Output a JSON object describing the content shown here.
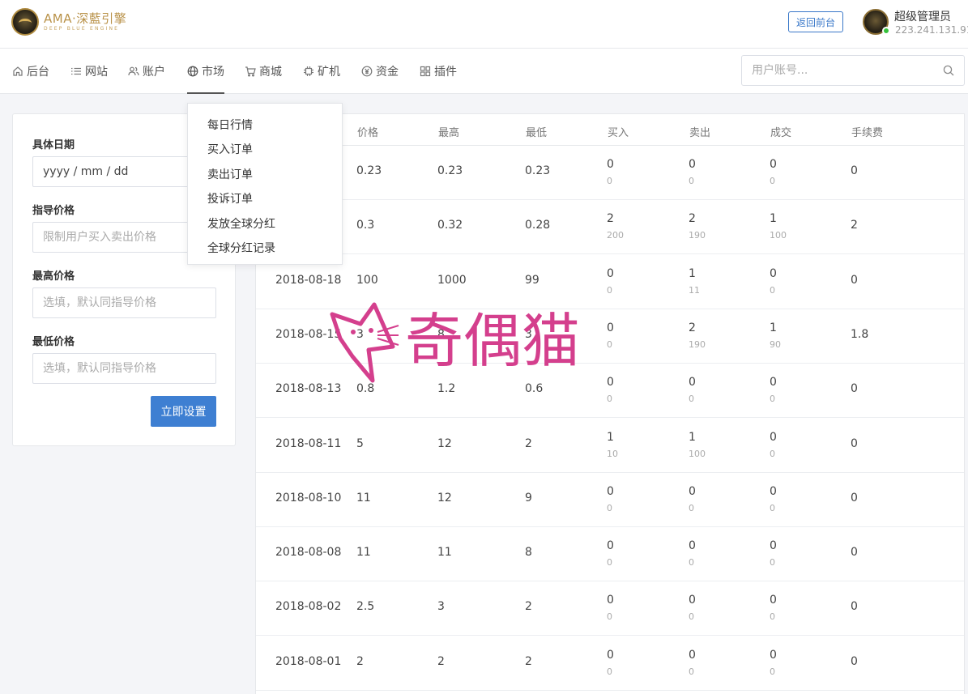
{
  "header": {
    "logo_main": "AMA·深藍引擎",
    "logo_sub": "DEEP BLUE ENGINE",
    "back_button": "返回前台",
    "user_name": "超级管理员",
    "user_ip": "223.241.131.91"
  },
  "nav": {
    "items": [
      {
        "label": "后台",
        "icon": "home-icon"
      },
      {
        "label": "网站",
        "icon": "list-icon"
      },
      {
        "label": "账户",
        "icon": "users-icon"
      },
      {
        "label": "市场",
        "icon": "globe-icon"
      },
      {
        "label": "商城",
        "icon": "cart-icon"
      },
      {
        "label": "矿机",
        "icon": "chip-icon"
      },
      {
        "label": "资金",
        "icon": "yen-icon"
      },
      {
        "label": "插件",
        "icon": "grid-icon"
      }
    ],
    "active": "市场",
    "search_placeholder": "用户账号..."
  },
  "dropdown": {
    "items": [
      "每日行情",
      "买入订单",
      "卖出订单",
      "投诉订单",
      "发放全球分红",
      "全球分红记录"
    ]
  },
  "form": {
    "date_label": "具体日期",
    "date_value": "yyyy / mm / dd",
    "guide_label": "指导价格",
    "guide_placeholder": "限制用户买入卖出价格",
    "max_label": "最高价格",
    "max_placeholder": "选填，默认同指导价格",
    "min_label": "最低价格",
    "min_placeholder": "选填，默认同指导价格",
    "submit": "立即设置"
  },
  "table": {
    "headers": [
      "价格",
      "最高",
      "最低",
      "买入",
      "卖出",
      "成交",
      "手续费"
    ],
    "rows": [
      {
        "date": "",
        "price": "0.23",
        "high": "0.23",
        "low": "0.23",
        "buy": "0",
        "buy_sub": "0",
        "sell": "0",
        "sell_sub": "0",
        "deal": "0",
        "deal_sub": "0",
        "fee": "0"
      },
      {
        "date": "",
        "price": "0.3",
        "high": "0.32",
        "low": "0.28",
        "buy": "2",
        "buy_sub": "200",
        "sell": "2",
        "sell_sub": "190",
        "deal": "1",
        "deal_sub": "100",
        "fee": "2"
      },
      {
        "date": "2018-08-18",
        "price": "100",
        "high": "1000",
        "low": "99",
        "buy": "0",
        "buy_sub": "0",
        "sell": "1",
        "sell_sub": "11",
        "deal": "0",
        "deal_sub": "0",
        "fee": "0"
      },
      {
        "date": "2018-08-15",
        "price": "3",
        "high": "8",
        "low": "3",
        "buy": "0",
        "buy_sub": "0",
        "sell": "2",
        "sell_sub": "190",
        "deal": "1",
        "deal_sub": "90",
        "fee": "1.8"
      },
      {
        "date": "2018-08-13",
        "price": "0.8",
        "high": "1.2",
        "low": "0.6",
        "buy": "0",
        "buy_sub": "0",
        "sell": "0",
        "sell_sub": "0",
        "deal": "0",
        "deal_sub": "0",
        "fee": "0"
      },
      {
        "date": "2018-08-11",
        "price": "5",
        "high": "12",
        "low": "2",
        "buy": "1",
        "buy_sub": "10",
        "sell": "1",
        "sell_sub": "100",
        "deal": "0",
        "deal_sub": "0",
        "fee": "0"
      },
      {
        "date": "2018-08-10",
        "price": "11",
        "high": "12",
        "low": "9",
        "buy": "0",
        "buy_sub": "0",
        "sell": "0",
        "sell_sub": "0",
        "deal": "0",
        "deal_sub": "0",
        "fee": "0"
      },
      {
        "date": "2018-08-08",
        "price": "11",
        "high": "11",
        "low": "8",
        "buy": "0",
        "buy_sub": "0",
        "sell": "0",
        "sell_sub": "0",
        "deal": "0",
        "deal_sub": "0",
        "fee": "0"
      },
      {
        "date": "2018-08-02",
        "price": "2.5",
        "high": "3",
        "low": "2",
        "buy": "0",
        "buy_sub": "0",
        "sell": "0",
        "sell_sub": "0",
        "deal": "0",
        "deal_sub": "0",
        "fee": "0"
      },
      {
        "date": "2018-08-01",
        "price": "2",
        "high": "2",
        "low": "2",
        "buy": "0",
        "buy_sub": "0",
        "sell": "0",
        "sell_sub": "0",
        "deal": "0",
        "deal_sub": "0",
        "fee": "0"
      }
    ]
  },
  "watermark": {
    "text": "奇偶猫"
  }
}
